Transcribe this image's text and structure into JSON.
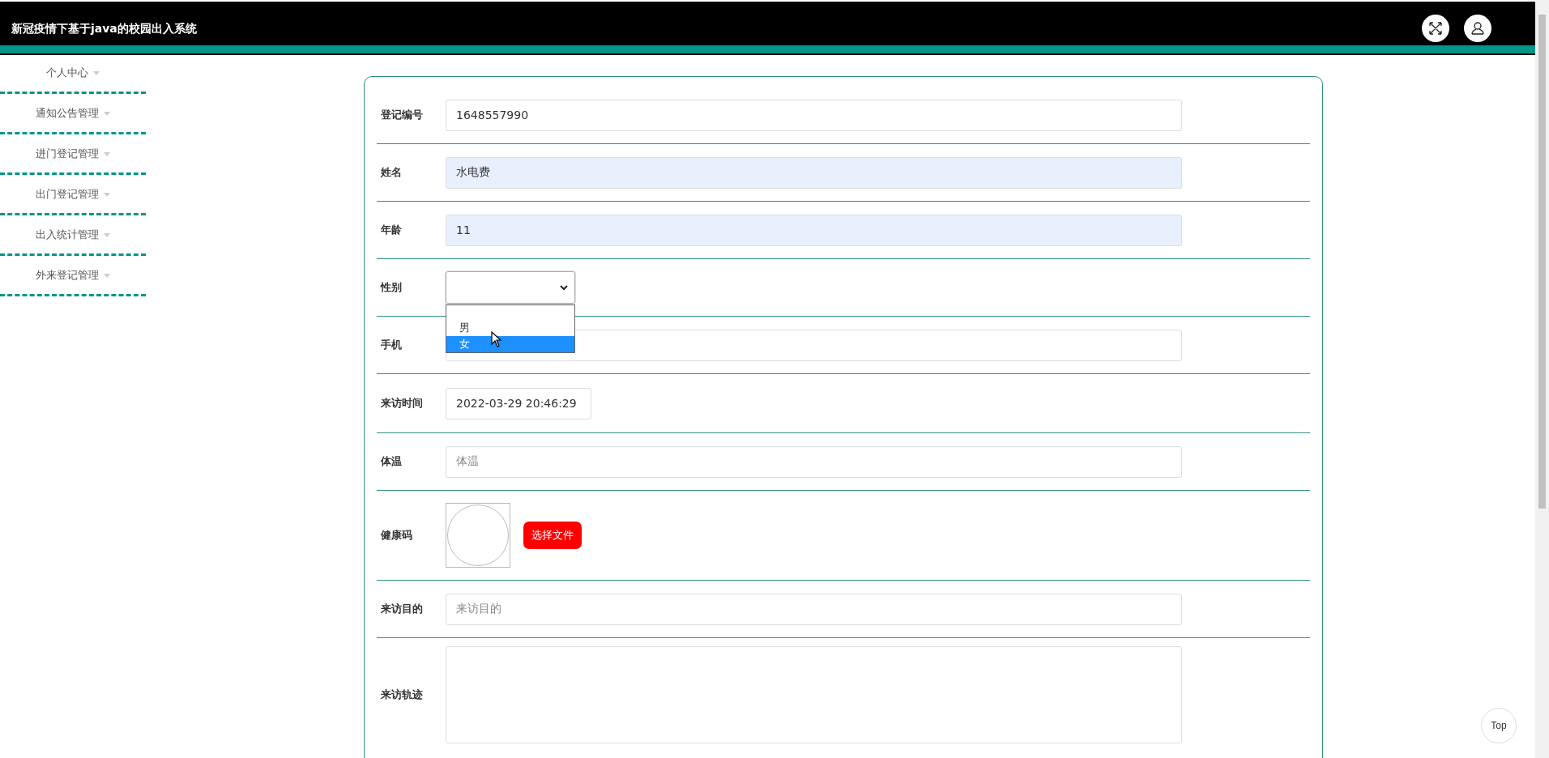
{
  "header": {
    "title": "新冠疫情下基于java的校园出入系统"
  },
  "sidebar": {
    "items": [
      {
        "label": "个人中心"
      },
      {
        "label": "通知公告管理"
      },
      {
        "label": "进门登记管理"
      },
      {
        "label": "出门登记管理"
      },
      {
        "label": "出入统计管理"
      },
      {
        "label": "外来登记管理"
      }
    ]
  },
  "form": {
    "fields": [
      {
        "kind": "text",
        "label": "登记编号",
        "value": "1648557990",
        "autofilled": false
      },
      {
        "kind": "text",
        "label": "姓名",
        "value": "水电费",
        "autofilled": true
      },
      {
        "kind": "text",
        "label": "年龄",
        "value": "11",
        "autofilled": true
      },
      {
        "kind": "select",
        "label": "性别",
        "expanded": true,
        "options": [
          {
            "label": "男",
            "selected": false
          },
          {
            "label": "女",
            "selected": true
          }
        ]
      },
      {
        "kind": "text",
        "label": "手机",
        "autofilled": false
      },
      {
        "kind": "datetime",
        "label": "来访时间",
        "value": "2022-03-29 20:46:29"
      },
      {
        "kind": "placeholder",
        "label": "体温",
        "placeholder": "体温"
      },
      {
        "kind": "upload",
        "label": "健康码",
        "button": "选择文件"
      },
      {
        "kind": "placeholder",
        "label": "来访目的",
        "placeholder": "来访目的"
      },
      {
        "kind": "textarea",
        "label": "来访轨迹"
      }
    ]
  },
  "top_button": {
    "label": "Top"
  }
}
